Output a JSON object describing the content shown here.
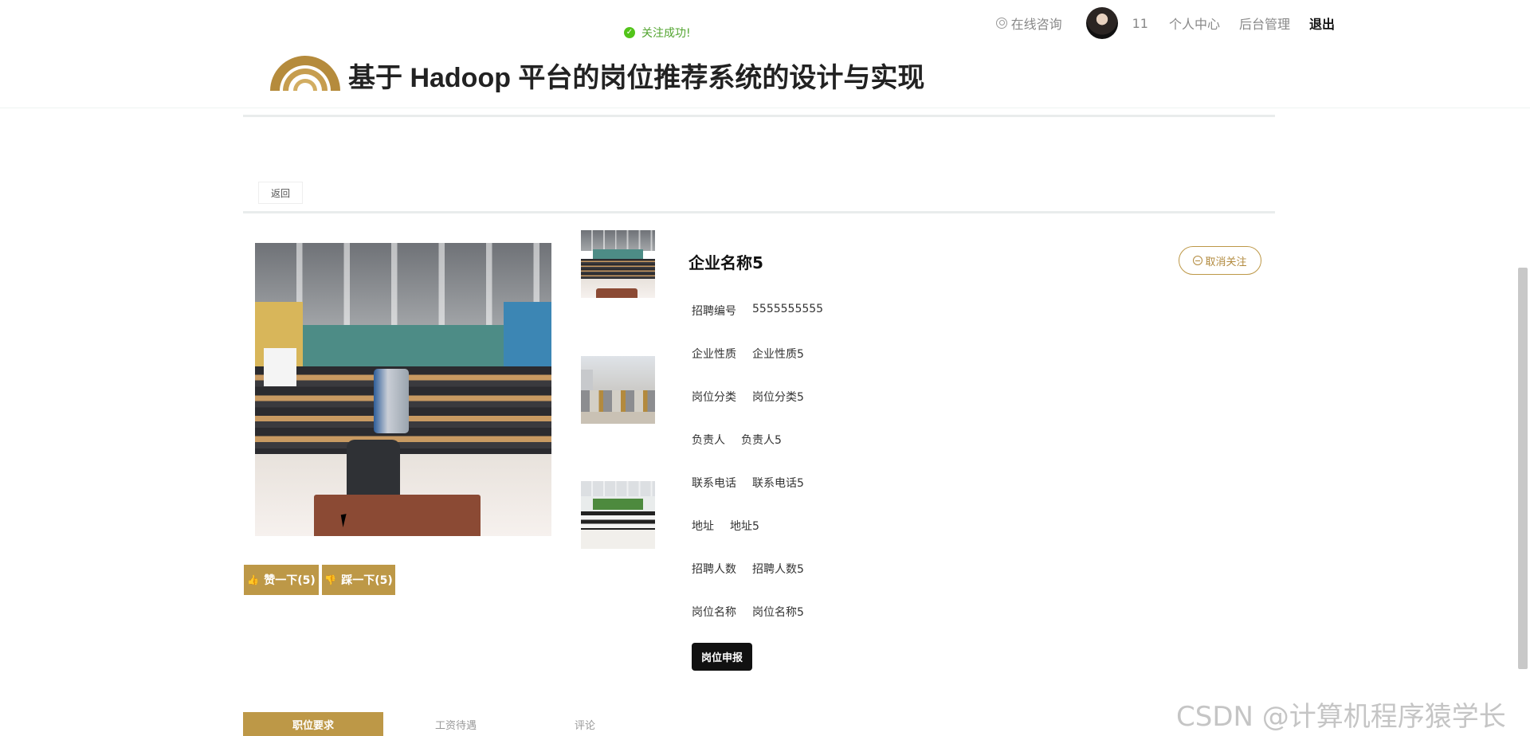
{
  "toast": {
    "text": "关注成功!"
  },
  "site": {
    "title": "基于 Hadoop 平台的岗位推荐系统的设计与实现"
  },
  "nav": {
    "consult": "在线咨询",
    "user_id": "11",
    "profile": "个人中心",
    "admin": "后台管理",
    "logout": "退出"
  },
  "back": "返回",
  "job": {
    "company": "企业名称5",
    "unfollow": "取消关注",
    "fields": [
      {
        "label": "招聘编号",
        "value": "5555555555"
      },
      {
        "label": "企业性质",
        "value": "企业性质5"
      },
      {
        "label": "岗位分类",
        "value": "岗位分类5"
      },
      {
        "label": "负责人",
        "value": "负责人5"
      },
      {
        "label": "联系电话",
        "value": "联系电话5"
      },
      {
        "label": "地址",
        "value": "地址5"
      },
      {
        "label": "招聘人数",
        "value": "招聘人数5"
      },
      {
        "label": "岗位名称",
        "value": "岗位名称5"
      }
    ],
    "apply": "岗位申报"
  },
  "votes": {
    "like": "赞一下(5)",
    "dislike": "踩一下(5)"
  },
  "tabs": [
    "职位要求",
    "工资待遇",
    "评论"
  ],
  "watermark": "CSDN @计算机程序猿学长",
  "icons": {
    "toast": "check-circle-icon",
    "consult": "user-circle-icon",
    "like": "thumb-up-icon",
    "dislike": "thumb-down-icon",
    "unfollow": "minus-circle-icon"
  },
  "colors": {
    "accent": "#bd9847",
    "success": "#52c41a",
    "dark_button": "#111111"
  }
}
